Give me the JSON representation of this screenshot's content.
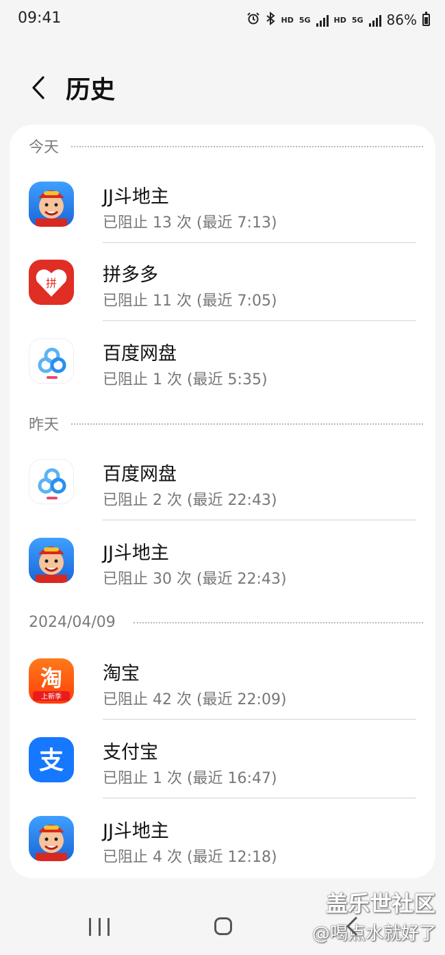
{
  "status_bar": {
    "time": "09:41",
    "hd1": "HD",
    "net1": "5G",
    "hd2": "HD",
    "net2": "5G",
    "battery": "86%"
  },
  "header": {
    "title": "历史",
    "back_icon": "chevron-left-icon"
  },
  "sections": [
    {
      "label": "今天",
      "items": [
        {
          "app": "JJ斗地主",
          "detail": "已阻止 13 次 (最近 7:13)",
          "icon": "jj-doudizhu-icon"
        },
        {
          "app": "拼多多",
          "detail": "已阻止 11 次 (最近 7:05)",
          "icon": "pinduoduo-icon"
        },
        {
          "app": "百度网盘",
          "detail": "已阻止 1 次 (最近 5:35)",
          "icon": "baidu-netdisk-icon"
        }
      ]
    },
    {
      "label": "昨天",
      "items": [
        {
          "app": "百度网盘",
          "detail": "已阻止 2 次 (最近 22:43)",
          "icon": "baidu-netdisk-icon"
        },
        {
          "app": "JJ斗地主",
          "detail": "已阻止 30 次 (最近 22:43)",
          "icon": "jj-doudizhu-icon"
        }
      ]
    },
    {
      "label": "2024/04/09",
      "items": [
        {
          "app": "淘宝",
          "detail": "已阻止 42 次 (最近 22:09)",
          "icon": "taobao-icon"
        },
        {
          "app": "支付宝",
          "detail": "已阻止 1 次 (最近 16:47)",
          "icon": "alipay-icon"
        },
        {
          "app": "JJ斗地主",
          "detail": "已阻止 4 次 (最近 12:18)",
          "icon": "jj-doudizhu-icon"
        }
      ]
    }
  ],
  "icon_text": {
    "pdd": "拼",
    "taobao": "淘",
    "taobao_badge": "上新季",
    "alipay": "支"
  },
  "watermark": {
    "line1": "盖乐世社区",
    "line2": "@喝点水就好了"
  },
  "colors": {
    "background": "#f5f5f5",
    "card": "#ffffff",
    "pinduoduo": "#e02e24",
    "taobao": "#ff5a12",
    "alipay": "#1677ff",
    "jj": "#2a7ff0"
  }
}
